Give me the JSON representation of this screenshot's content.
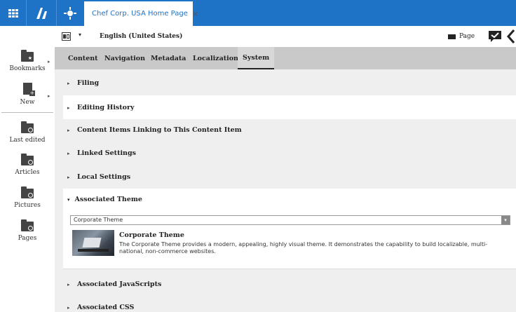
{
  "topbar": {
    "tab_label": "Chef Corp. USA Home Page",
    "tab_close": "×",
    "accent_color": "#1e73c7"
  },
  "sidebar": {
    "items": [
      {
        "label": "Bookmarks",
        "icon": "bookmarks-folder-icon"
      },
      {
        "label": "New",
        "icon": "new-document-icon"
      },
      {
        "label": "Last edited",
        "icon": "last-edited-folder-icon"
      },
      {
        "label": "Articles",
        "icon": "articles-folder-icon"
      },
      {
        "label": "Pictures",
        "icon": "pictures-folder-icon"
      },
      {
        "label": "Pages",
        "icon": "pages-folder-icon"
      }
    ]
  },
  "toolbar": {
    "language_label": "English (United States)",
    "page_label": "Page"
  },
  "tabs": [
    {
      "label": "Content"
    },
    {
      "label": "Navigation"
    },
    {
      "label": "Metadata"
    },
    {
      "label": "Localization"
    },
    {
      "label": "System",
      "active": true
    }
  ],
  "sections": {
    "filing": "Filing",
    "editing_history": "Editing History",
    "linking_items": "Content Items Linking to This Content Item",
    "linked_settings": "Linked Settings",
    "local_settings": "Local Settings",
    "associated_theme": "Associated Theme",
    "associated_js": "Associated JavaScripts",
    "associated_css": "Associated CSS"
  },
  "theme": {
    "selected": "Corporate Theme",
    "title": "Corporate Theme",
    "description": "The Corporate Theme provides a modern, appealing, highly visual theme. It demonstrates the capability to build localizable, multi-national, non-commerce websites."
  }
}
